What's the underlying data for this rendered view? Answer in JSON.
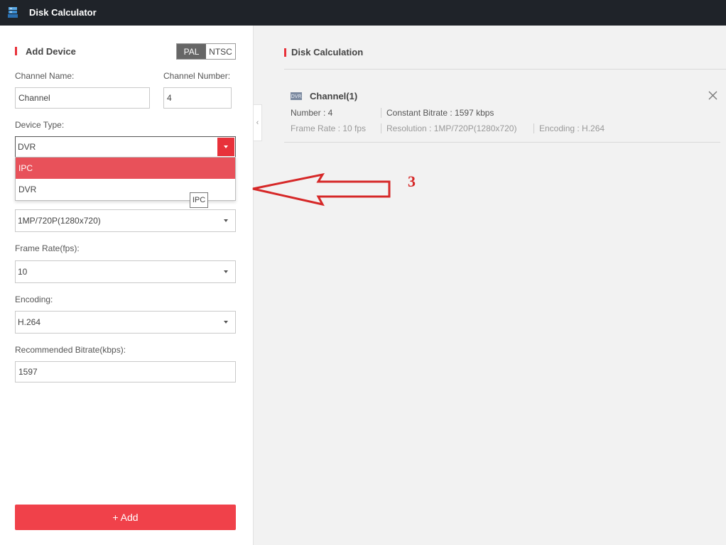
{
  "app": {
    "title": "Disk Calculator"
  },
  "left": {
    "section_title": "Add Device",
    "standard_options": [
      "PAL",
      "NTSC"
    ],
    "selected_standard": "PAL",
    "channel_name": {
      "label": "Channel Name:",
      "value": "Channel"
    },
    "channel_number": {
      "label": "Channel Number:",
      "value": "4"
    },
    "device_type": {
      "label": "Device Type:",
      "value": "DVR",
      "options": [
        "IPC",
        "DVR"
      ],
      "highlighted": "IPC"
    },
    "tooltip": "IPC",
    "resolution": {
      "value": "1MP/720P(1280x720)"
    },
    "frame_rate": {
      "label": "Frame Rate(fps):",
      "value": "10"
    },
    "encoding": {
      "label": "Encoding:",
      "value": "H.264"
    },
    "bitrate": {
      "label": "Recommended Bitrate(kbps):",
      "value": "1597"
    },
    "add_button": "+ Add"
  },
  "right": {
    "section_title": "Disk Calculation",
    "channel": {
      "icon_text": "DVR",
      "title": "Channel(1)",
      "number": "Number : 4",
      "constant_bitrate": "Constant Bitrate : 1597 kbps",
      "frame_rate": "Frame Rate : 10 fps",
      "resolution": "Resolution : 1MP/720P(1280x720)",
      "encoding": "Encoding : H.264"
    }
  },
  "annotation": {
    "number": "3"
  },
  "colors": {
    "accent": "#e8313a",
    "titlebar": "#1f2329",
    "add_button": "#f0414a",
    "annotation": "#d62828"
  }
}
